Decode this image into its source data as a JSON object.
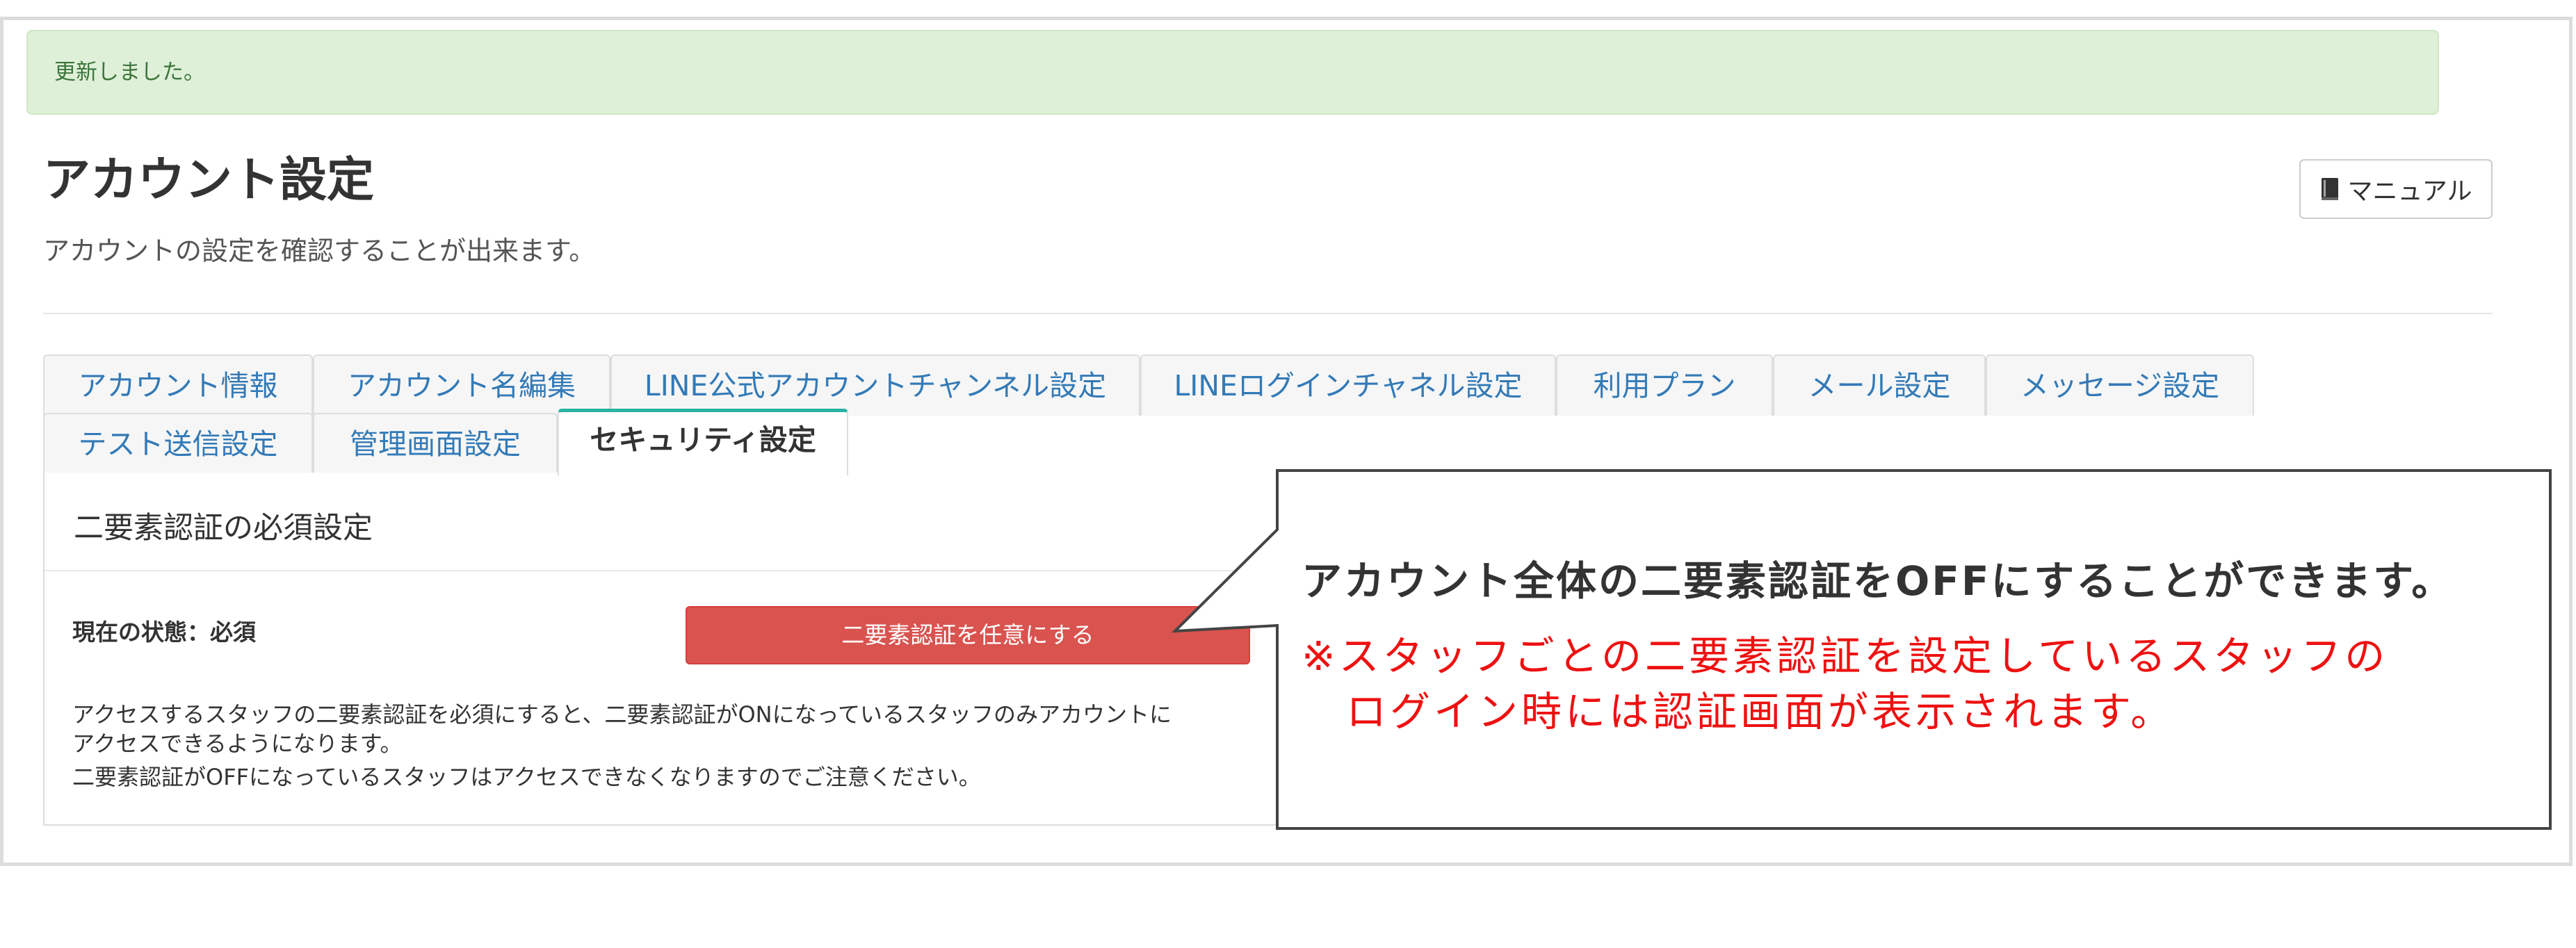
{
  "alert": {
    "message": "更新しました。"
  },
  "header": {
    "title": "アカウント設定",
    "subtitle": "アカウントの設定を確認することが出来ます。",
    "manual_button": "マニュアル",
    "manual_icon": "book-icon"
  },
  "tabs": [
    {
      "label": "アカウント情報"
    },
    {
      "label": "アカウント名編集"
    },
    {
      "label": "LINE公式アカウントチャンネル設定"
    },
    {
      "label": "LINEログインチャネル設定"
    },
    {
      "label": "利用プラン"
    },
    {
      "label": "メール設定"
    },
    {
      "label": "メッセージ設定"
    },
    {
      "label": "テスト送信設定"
    },
    {
      "label": "管理画面設定"
    },
    {
      "label": "セキュリティ設定",
      "active": true
    }
  ],
  "security": {
    "section_title": "二要素認証の必須設定",
    "status_label": "現在の状態：必須",
    "optional_button": "二要素認証を任意にする",
    "help_lines": [
      "アクセスするスタッフの二要素認証を必須にすると、二要素認証がONになっているスタッフのみアカウントに",
      "アクセスできるようになります。",
      "二要素認証がOFFになっているスタッフはアクセスできなくなりますのでご注意ください。"
    ]
  },
  "callout": {
    "title": "アカウント全体の二要素認証をOFFにすることができます。",
    "note_line1": "※スタッフごとの二要素認証を設定しているスタッフの",
    "note_line2": "ログイン時には認証画面が表示されます。",
    "note_color": "#ee1111"
  },
  "colors": {
    "alert_bg": "#dff0d8",
    "alert_text": "#3c763d",
    "tab_link": "#337ab7",
    "active_tab_accent": "#2ab3a3",
    "danger_button": "#d9534f"
  }
}
